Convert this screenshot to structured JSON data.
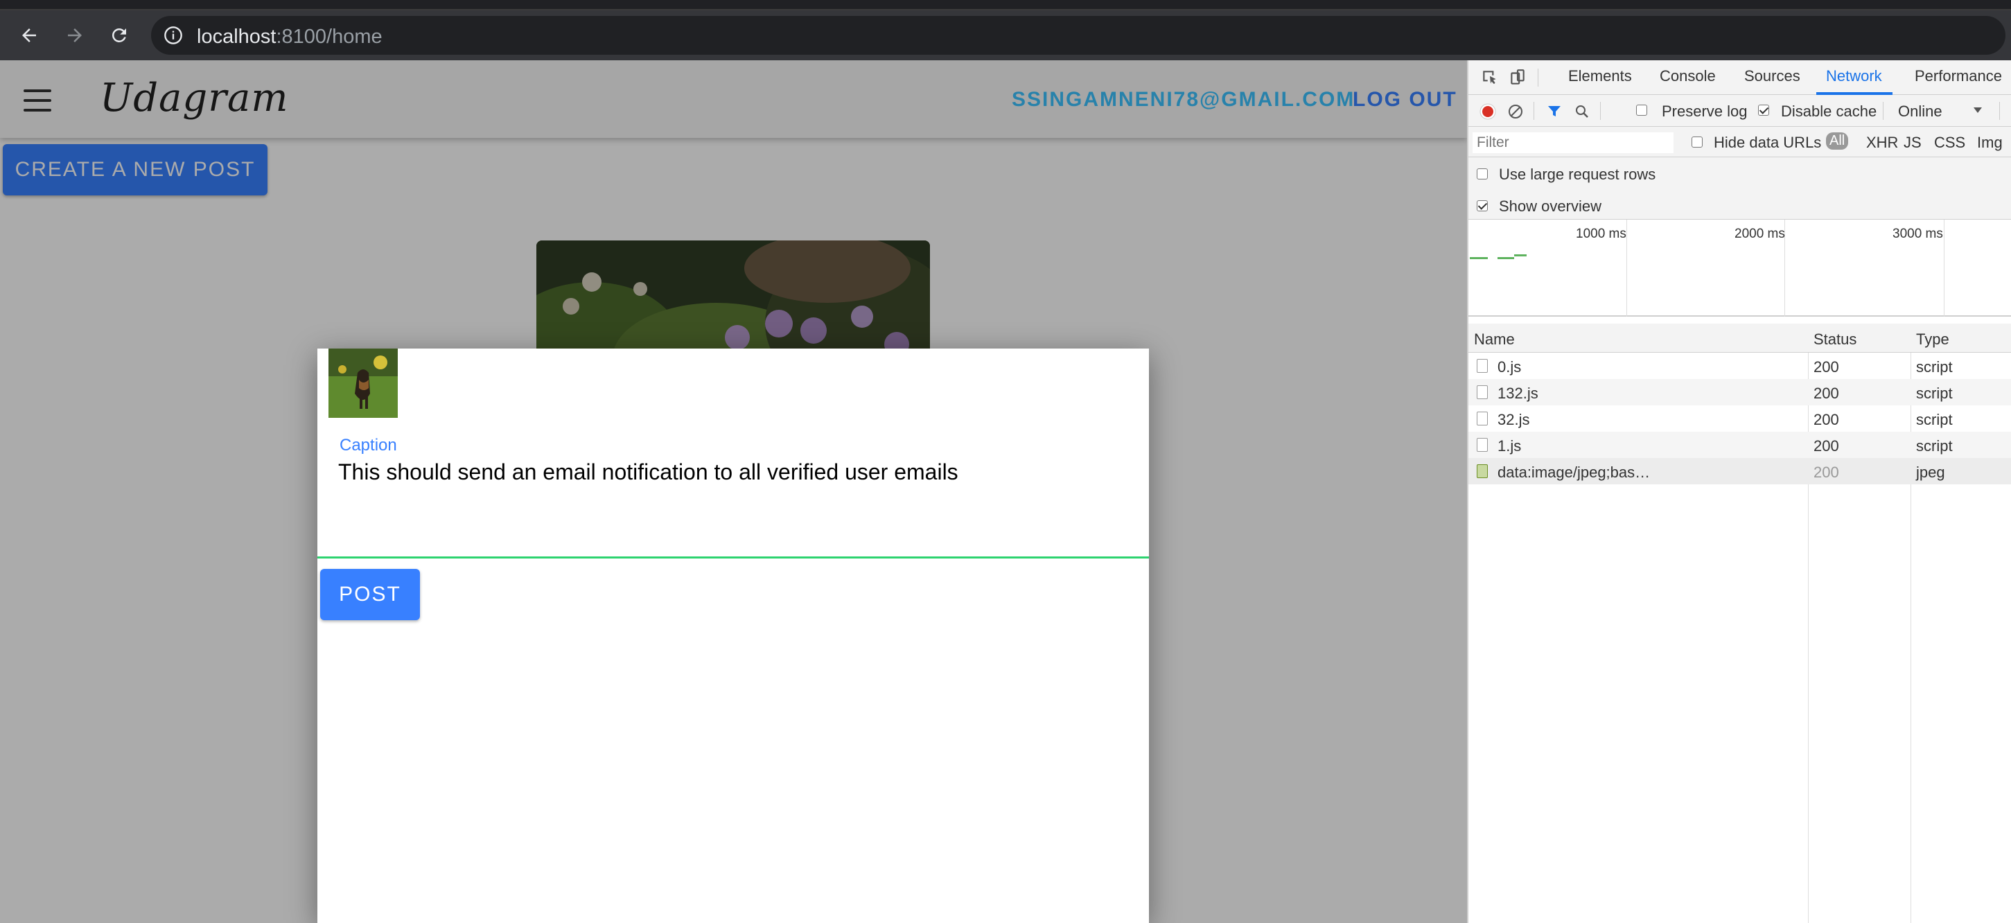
{
  "browser": {
    "url_host": "localhost",
    "url_rest": ":8100/home"
  },
  "app": {
    "brand": "Udagram",
    "user_email": "SSINGAMNENI78@GMAIL.COM",
    "logout_label": "LOG OUT",
    "create_post_label": "CREATE A NEW POST"
  },
  "modal": {
    "caption_label": "Caption",
    "caption_value": "This should send an email notification to all verified user emails",
    "post_label": "POST"
  },
  "devtools": {
    "tabs": [
      "Elements",
      "Console",
      "Sources",
      "Network",
      "Performance"
    ],
    "active_tab": "Network",
    "toolbar": {
      "preserve_log": "Preserve log",
      "disable_cache": "Disable cache",
      "throttle": "Online"
    },
    "filter": {
      "placeholder": "Filter",
      "hide_data_urls": "Hide data URLs",
      "types": [
        "All",
        "XHR",
        "JS",
        "CSS",
        "Img"
      ]
    },
    "settings": {
      "large_rows": "Use large request rows",
      "show_overview": "Show overview"
    },
    "overview_ticks": [
      "1000 ms",
      "2000 ms",
      "3000 ms"
    ],
    "columns": [
      "Name",
      "Status",
      "Type"
    ],
    "rows": [
      {
        "name": "0.js",
        "status": "200",
        "type": "script"
      },
      {
        "name": "132.js",
        "status": "200",
        "type": "script"
      },
      {
        "name": "32.js",
        "status": "200",
        "type": "script"
      },
      {
        "name": "1.js",
        "status": "200",
        "type": "script"
      },
      {
        "name": "data:image/jpeg;bas…",
        "status": "200",
        "type": "jpeg"
      }
    ]
  },
  "colors": {
    "primary": "#3880ff",
    "secondary": "#3dc2ff",
    "success": "#2dd36f",
    "devtools_accent": "#1a73e8"
  }
}
